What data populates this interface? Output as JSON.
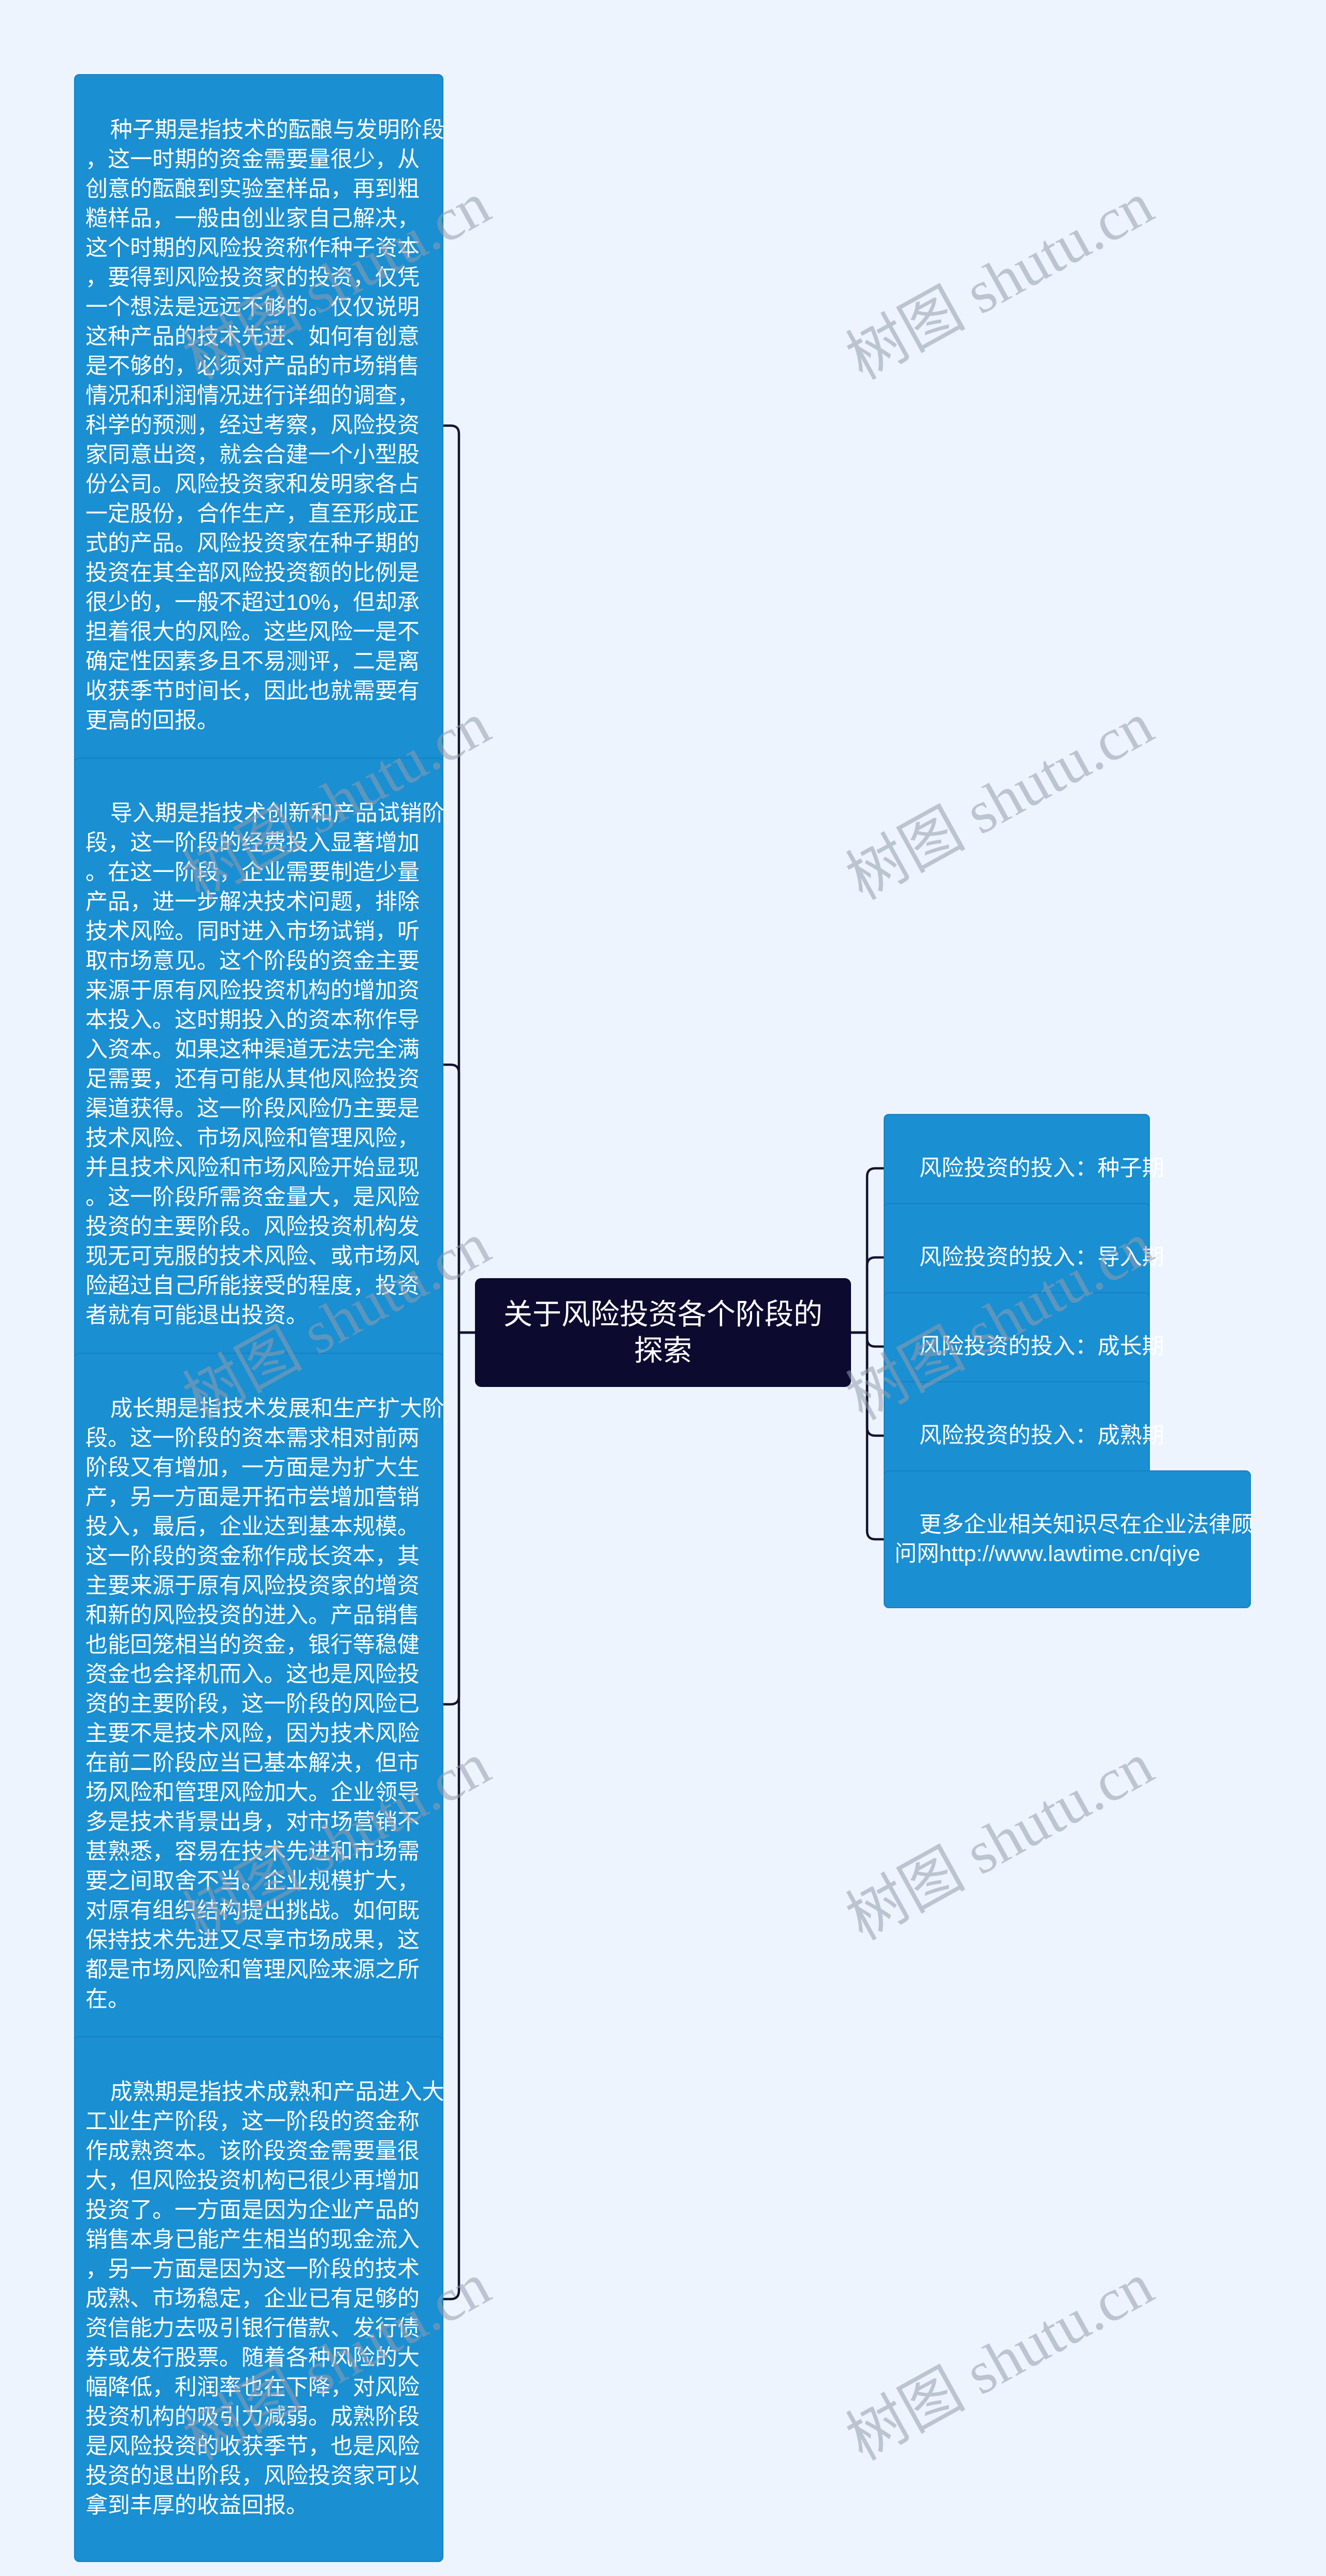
{
  "theme": {
    "background": "#edf4fe",
    "node_color": "#1a8fd2",
    "root_color": "#0c0a2e",
    "connector_color": "#14132e"
  },
  "mindmap": {
    "root": {
      "title": "关于风险投资各个阶段的\n探索"
    },
    "left_branches": [
      {
        "stage": "种子期",
        "text": "种子期是指技术的酝酿与发明阶段\n，这一时期的资金需要量很少，从\n创意的酝酿到实验室样品，再到粗\n糙样品，一般由创业家自己解决，\n这个时期的风险投资称作种子资本\n，要得到风险投资家的投资，仅凭\n一个想法是远远不够的。仅仅说明\n这种产品的技术先进、如何有创意\n是不够的，必须对产品的市场销售\n情况和利润情况进行详细的调查，\n科学的预测，经过考察，风险投资\n家同意出资，就会合建一个小型股\n份公司。风险投资家和发明家各占\n一定股份，合作生产，直至形成正\n式的产品。风险投资家在种子期的\n投资在其全部风险投资额的比例是\n很少的，一般不超过10%，但却承\n担着很大的风险。这些风险一是不\n确定性因素多且不易测评，二是离\n收获季节时间长，因此也就需要有\n更高的回报。"
      },
      {
        "stage": "导入期",
        "text": "导入期是指技术创新和产品试销阶\n段，这一阶段的经费投入显著增加\n。在这一阶段，企业需要制造少量\n产品，进一步解决技术问题，排除\n技术风险。同时进入市场试销，听\n取市场意见。这个阶段的资金主要\n来源于原有风险投资机构的增加资\n本投入。这时期投入的资本称作导\n入资本。如果这种渠道无法完全满\n足需要，还有可能从其他风险投资\n渠道获得。这一阶段风险仍主要是\n技术风险、市场风险和管理风险，\n并且技术风险和市场风险开始显现\n。这一阶段所需资金量大，是风险\n投资的主要阶段。风险投资机构发\n现无可克服的技术风险、或市场风\n险超过自己所能接受的程度，投资\n者就有可能退出投资。"
      },
      {
        "stage": "成长期",
        "text": "成长期是指技术发展和生产扩大阶\n段。这一阶段的资本需求相对前两\n阶段又有增加，一方面是为扩大生\n产，另一方面是开拓市尝增加营销\n投入，最后，企业达到基本规模。\n这一阶段的资金称作成长资本，其\n主要来源于原有风险投资家的增资\n和新的风险投资的进入。产品销售\n也能回笼相当的资金，银行等稳健\n资金也会择机而入。这也是风险投\n资的主要阶段，这一阶段的风险已\n主要不是技术风险，因为技术风险\n在前二阶段应当已基本解决，但市\n场风险和管理风险加大。企业领导\n多是技术背景出身，对市场营销不\n甚熟悉，容易在技术先进和市场需\n要之间取舍不当。企业规模扩大，\n对原有组织结构提出挑战。如何既\n保持技术先进又尽享市场成果，这\n都是市场风险和管理风险来源之所\n在。"
      },
      {
        "stage": "成熟期",
        "text": "成熟期是指技术成熟和产品进入大\n工业生产阶段，这一阶段的资金称\n作成熟资本。该阶段资金需要量很\n大，但风险投资机构已很少再增加\n投资了。一方面是因为企业产品的\n销售本身已能产生相当的现金流入\n，另一方面是因为这一阶段的技术\n成熟、市场稳定，企业已有足够的\n资信能力去吸引银行借款、发行债\n券或发行股票。随着各种风险的大\n幅降低，利润率也在下降，对风险\n投资机构的吸引力减弱。成熟阶段\n是风险投资的收获季节，也是风险\n投资的退出阶段，风险投资家可以\n拿到丰厚的收益回报。"
      }
    ],
    "right_branches": [
      {
        "label": "风险投资的投入：种子期"
      },
      {
        "label": "风险投资的投入：导入期"
      },
      {
        "label": "风险投资的投入：成长期"
      },
      {
        "label": "风险投资的投入：成熟期"
      },
      {
        "label": "更多企业相关知识尽在企业法律顾\n问网http://www.lawtime.cn/qiye"
      }
    ]
  },
  "watermark": {
    "text": "树图 shutu.cn"
  }
}
